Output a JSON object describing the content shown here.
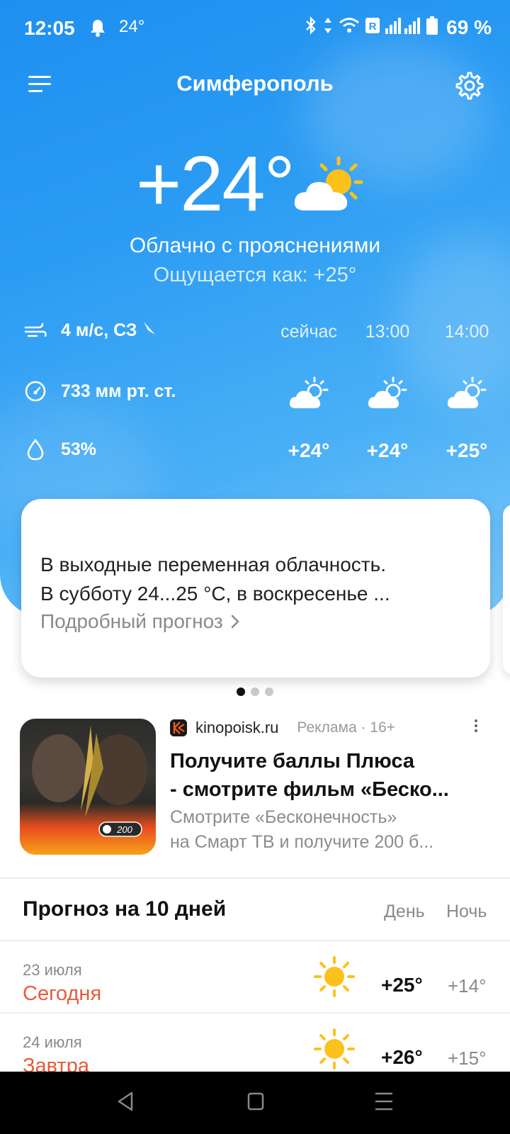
{
  "status_bar": {
    "time": "12:05",
    "notif_temp": "24°",
    "battery_pct": "69 %"
  },
  "header": {
    "city": "Симферополь"
  },
  "current": {
    "temperature": "+24°",
    "condition": "Облачно с прояснениями",
    "feels_like": "Ощущается как: +25°",
    "icon": "partly-cloudy-icon"
  },
  "metrics": {
    "wind": "4 м/с, СЗ",
    "pressure": "733 мм рт. ст.",
    "humidity": "53%"
  },
  "hourly": [
    {
      "label": "сейчас",
      "temp": "+24°",
      "icon": "partly-cloudy-icon"
    },
    {
      "label": "13:00",
      "temp": "+24°",
      "icon": "partly-cloudy-icon"
    },
    {
      "label": "14:00",
      "temp": "+25°",
      "icon": "partly-cloudy-icon"
    }
  ],
  "summary_card": {
    "line1": "В выходные переменная облачность.",
    "line2": "В субботу 24...25 °C, в воскресенье ...",
    "link": "Подробный прогноз"
  },
  "ad": {
    "source": "kinopoisk.ru",
    "meta": "Реклама · 16+",
    "title_line1": "Получите баллы Плюса",
    "title_line2": "- смотрите фильм «Беско...",
    "desc_line1": "Смотрите  «Бесконечность»",
    "desc_line2": "на Смарт ТВ и получите 200 б...",
    "image_badge": "200"
  },
  "forecast": {
    "title": "Прогноз на 10 дней",
    "day_header": "День",
    "night_header": "Ночь",
    "rows": [
      {
        "date": "23 июля",
        "name": "Сегодня",
        "day": "+25°",
        "night": "+14°",
        "icon": "sun-icon"
      },
      {
        "date": "24 июля",
        "name": "Завтра",
        "day": "+26°",
        "night": "+15°",
        "icon": "sun-icon"
      }
    ]
  },
  "colors": {
    "hero_blue": "#2b9cf3",
    "accent_red": "#e85b3a",
    "sun_yellow": "#fcc21b"
  }
}
